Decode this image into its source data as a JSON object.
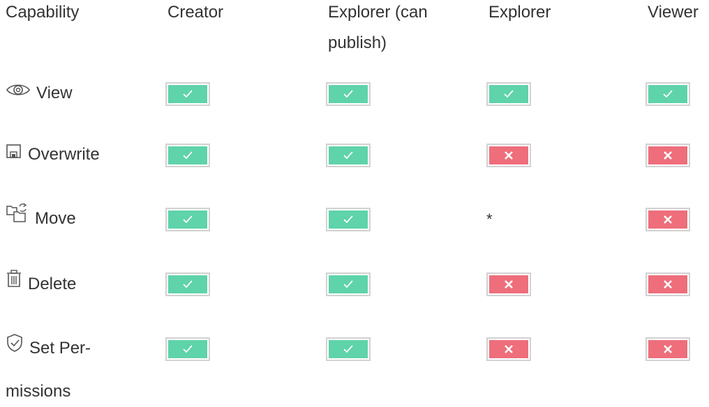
{
  "header": {
    "capability": "Capability",
    "creator": "Creator",
    "explorer_publish": "Explorer (can publish)",
    "explorer": "Explorer",
    "viewer": "Viewer"
  },
  "rows": [
    {
      "icon": "eye-icon",
      "label": "View",
      "creator": "allowed",
      "explorer_publish": "allowed",
      "explorer": "allowed",
      "viewer": "allowed"
    },
    {
      "icon": "save-icon",
      "label": "Overwrite",
      "creator": "allowed",
      "explorer_publish": "allowed",
      "explorer": "denied",
      "viewer": "denied"
    },
    {
      "icon": "move-icon",
      "label": "Move",
      "creator": "allowed",
      "explorer_publish": "allowed",
      "explorer": "*",
      "viewer": "denied"
    },
    {
      "icon": "trash-icon",
      "label": "Delete",
      "creator": "allowed",
      "explorer_publish": "allowed",
      "explorer": "denied",
      "viewer": "denied"
    },
    {
      "icon": "shield-check-icon",
      "label": "Set Per-missions",
      "label_line1": "Set Per-",
      "label_line2": "missions",
      "creator": "allowed",
      "explorer_publish": "allowed",
      "explorer": "denied",
      "viewer": "denied"
    }
  ],
  "colors": {
    "allowed": "#5fd3a9",
    "denied": "#ee6e7b",
    "badge_border": "#d2d2d2",
    "text": "#333333"
  }
}
